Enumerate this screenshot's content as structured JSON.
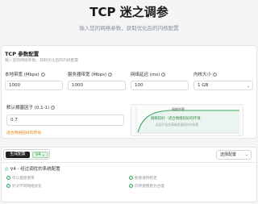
{
  "header": {
    "title": "TCP 迷之调参",
    "subtitle": "输入您的网络参数，获取优化后的内核配置"
  },
  "config": {
    "title": "TCP 参数配置",
    "subtitle": "输入您的网络参数，获取优化后的内核配置",
    "fields": [
      {
        "label": "本地带宽 (Mbps)",
        "value": "1000"
      },
      {
        "label": "服务器带宽 (Mbps)",
        "value": "1000"
      },
      {
        "label": "网络延迟 (ms)",
        "value": "100"
      },
      {
        "label": "内核大小",
        "value": "1 GB"
      }
    ],
    "factor_label": "默认拥塞因子 (0.1-1)",
    "factor_value": "0.7",
    "factor_hint": "适合网络较好的环境",
    "chart_caption_top": "网络平稳",
    "chart_caption_mid": "网络较好 - 适合网络较好的环境",
    "chart_caption_low": "此因子适合网络质量较好的场景"
  },
  "result": {
    "tab_active": "生成配置",
    "tab_version": "V4",
    "dropdown": "选择配置",
    "title": "V4 - 经过调优的系统配置",
    "features": [
      "可以直接使用",
      "能够保持稳定",
      "针对不同网络优化",
      "内存使用更为合理"
    ]
  },
  "colors": {
    "accent_green": "#3aa760",
    "hint_orange": "#e8860c"
  }
}
